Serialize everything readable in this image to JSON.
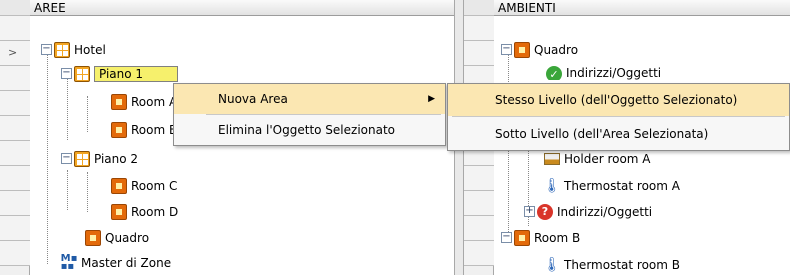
{
  "left": {
    "header": "AREE",
    "row_marker": ">",
    "rows": [
      "Hotel",
      "Piano 1",
      "Room A",
      "Room B",
      "Piano 2",
      "Room C",
      "Room D",
      "Quadro",
      "Master di Zone"
    ]
  },
  "right": {
    "header": "AMBIENTI",
    "rows": [
      "Quadro",
      "Indirizzi/Oggetti",
      "Holder room A",
      "Thermostat room A",
      "Indirizzi/Oggetti",
      "Room B",
      "Thermostat room B"
    ]
  },
  "context_menu": {
    "new_area": "Nuova Area",
    "delete": "Elimina l'Oggetto Selezionato"
  },
  "submenu": {
    "same_level": "Stesso Livello (dell'Oggetto Selezionato)",
    "sub_level": "Sotto Livello (dell'Area Selezionata)"
  },
  "colors": {
    "accent": "#e36a0a",
    "selection": "#f6f06c",
    "menu_highlight": "#fbe7b2"
  },
  "icons": [
    "area-icon",
    "area-group-icon",
    "check-icon",
    "question-icon",
    "thermometer-icon",
    "holder-icon",
    "master-zone-icon"
  ]
}
